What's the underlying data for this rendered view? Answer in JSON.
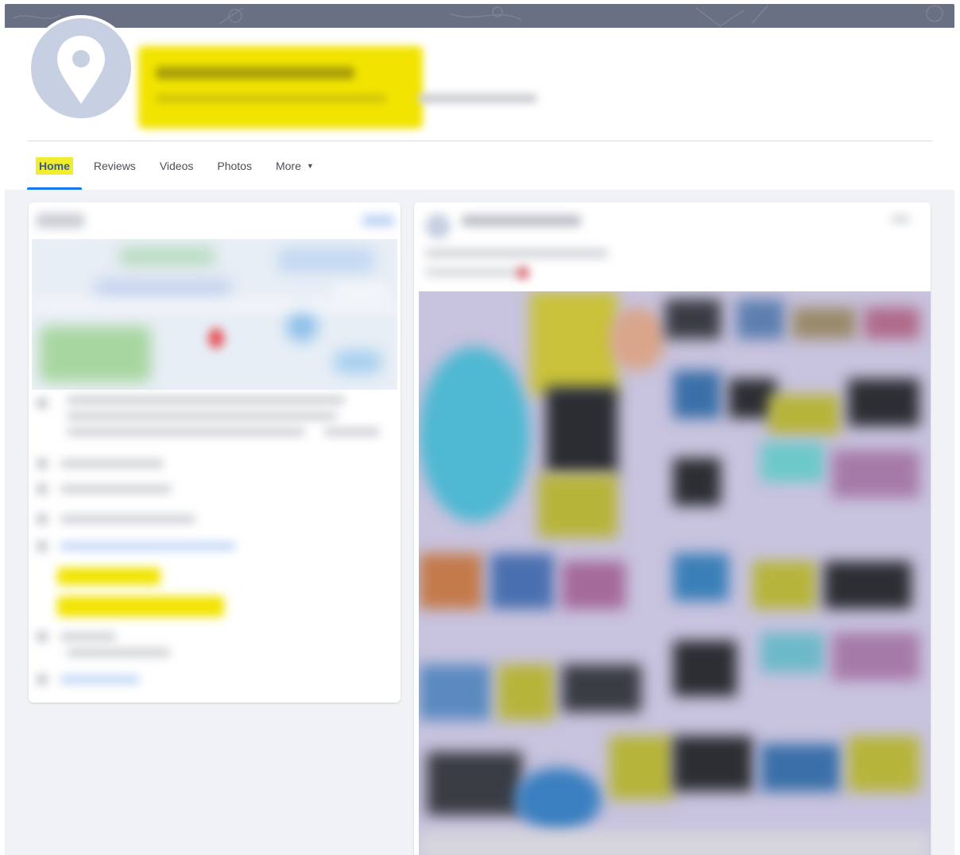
{
  "tabs": [
    {
      "label": "Home",
      "active": true
    },
    {
      "label": "Reviews",
      "active": false
    },
    {
      "label": "Videos",
      "active": false
    },
    {
      "label": "Photos",
      "active": false
    },
    {
      "label": "More",
      "active": false,
      "dropdown": true
    }
  ],
  "icons": {
    "avatar": "map-pin-icon",
    "more_dropdown": "caret-down-icon"
  },
  "colors": {
    "cover": "#6a7083",
    "avatar_bg": "#c7cfe2",
    "redaction": "#f2e400",
    "tab_active_underline": "#1877f2",
    "feed_bg": "#f0f2f5"
  }
}
